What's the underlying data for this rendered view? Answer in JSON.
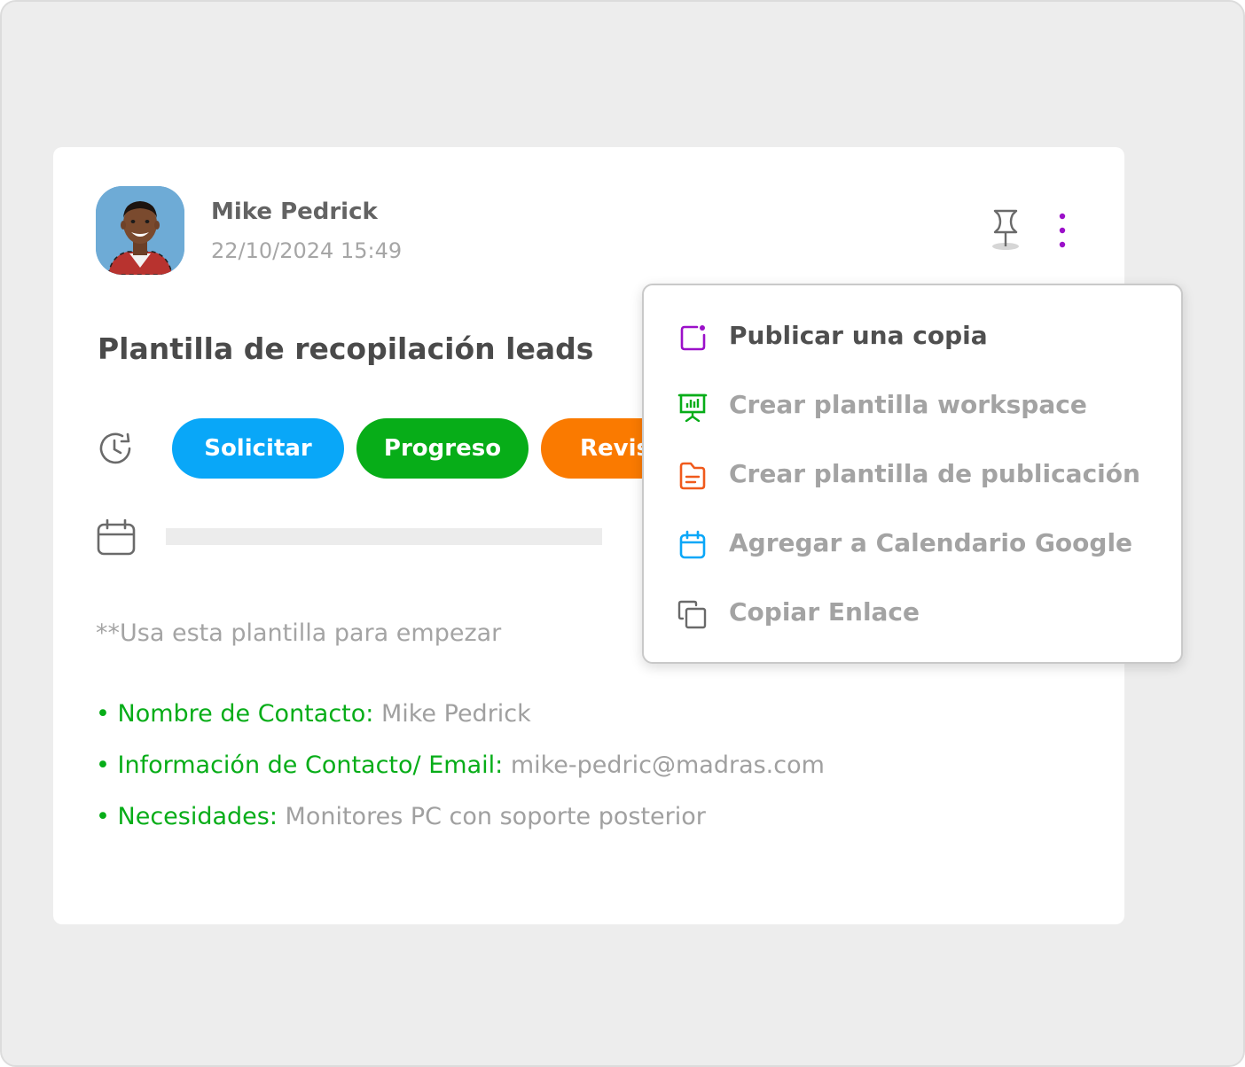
{
  "post": {
    "author_name": "Mike Pedrick",
    "timestamp": "22/10/2024 15:49",
    "title": "Plantilla de recopilación leads",
    "status_chips": [
      {
        "label": "Solicitar",
        "color": "#09a7f8"
      },
      {
        "label": "Progreso",
        "color": "#07ad18"
      },
      {
        "label": "Revis",
        "color": "#fa7a00"
      }
    ],
    "intro": "**Usa esta plantilla para empezar",
    "fields": [
      {
        "label": "• Nombre de Contacto:",
        "value": " Mike Pedrick"
      },
      {
        "label": "• Información de Contacto/ Email:",
        "value": " mike-pedric@madras.com"
      },
      {
        "label": "• Necesidades:",
        "value": " Monitores PC con soporte posterior"
      }
    ]
  },
  "icons": {
    "avatar": "avatar-photo",
    "pin": "pin-icon",
    "more": "vertical-dots-icon",
    "history": "clock-history-icon",
    "calendar": "calendar-icon"
  },
  "menu": {
    "items": [
      {
        "label": "Publicar una copia",
        "icon": "publish-copy-icon",
        "color": "#9b10c9"
      },
      {
        "label": "Crear plantilla workspace",
        "icon": "presentation-board-icon",
        "color": "#07ad18"
      },
      {
        "label": "Crear plantilla de publicación",
        "icon": "document-icon",
        "color": "#f05a1c"
      },
      {
        "label": "Agregar a Calendario Google",
        "icon": "calendar-icon",
        "color": "#09a7f8"
      },
      {
        "label": "Copiar Enlace",
        "icon": "copy-icon",
        "color": "#6a6a6a"
      }
    ]
  },
  "colors": {
    "background": "#ededed",
    "accent_purple": "#9b10c9",
    "label_green": "#07ad18"
  }
}
